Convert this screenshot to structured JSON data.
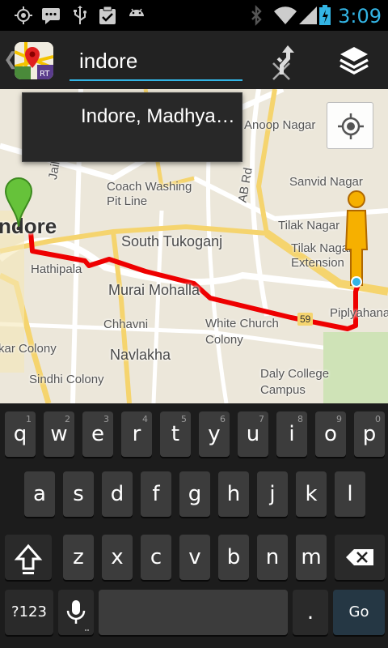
{
  "status_bar": {
    "time": "3:09",
    "icons": [
      "gps-icon",
      "chat-icon",
      "usb-icon",
      "clipboard-check-icon",
      "android-icon",
      "bluetooth-icon",
      "wifi-icon",
      "battery-icon",
      "signal-icon"
    ],
    "accent_color": "#33b5e5"
  },
  "action_bar": {
    "search_value": "indore",
    "icons": [
      "back-chevron-icon",
      "app-logo-icon",
      "clear-icon",
      "route-icon",
      "layers-icon"
    ]
  },
  "suggestion": {
    "text": "Indore, Madhya…"
  },
  "map": {
    "labels": [
      "Anoop Nagar",
      "Jail",
      "AB Rd",
      "Sanvid Nagar",
      "Coach Washing Pit Line",
      "ndore",
      "Tilak Nagar",
      "South Tukoganj",
      "Tilak Nagar Extension",
      "Hathipala",
      "Murai Mohalla",
      "Piplyahana",
      "59",
      "Chhavni",
      "White Church Colony",
      "kar Colony",
      "Navlakha",
      "Daly College Campus",
      "Sindhi Colony"
    ],
    "route_color": "#ee0000"
  },
  "keyboard": {
    "row1": [
      {
        "k": "q",
        "h": "1"
      },
      {
        "k": "w",
        "h": "2"
      },
      {
        "k": "e",
        "h": "3"
      },
      {
        "k": "r",
        "h": "4"
      },
      {
        "k": "t",
        "h": "5"
      },
      {
        "k": "y",
        "h": "6"
      },
      {
        "k": "u",
        "h": "7"
      },
      {
        "k": "i",
        "h": "8"
      },
      {
        "k": "o",
        "h": "9"
      },
      {
        "k": "p",
        "h": "0"
      }
    ],
    "row2": [
      "a",
      "s",
      "d",
      "f",
      "g",
      "h",
      "j",
      "k",
      "l"
    ],
    "row3": [
      "z",
      "x",
      "c",
      "v",
      "b",
      "n",
      "m"
    ],
    "sym_label": "?123",
    "period_label": ".",
    "go_label": "Go"
  }
}
